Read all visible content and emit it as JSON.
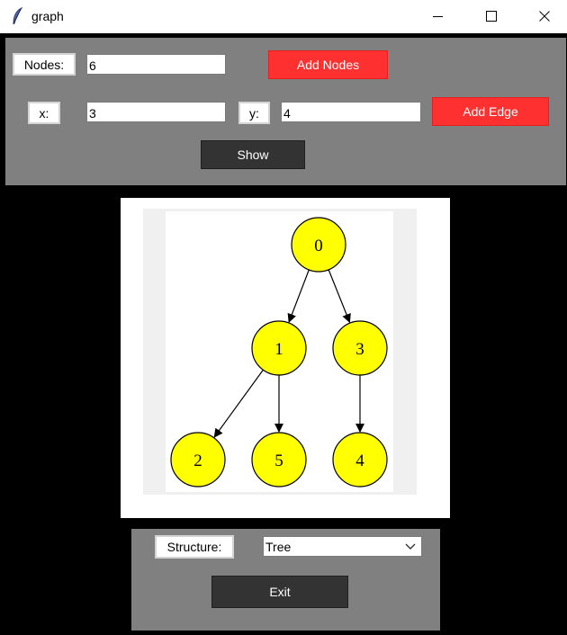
{
  "window": {
    "title": "graph",
    "app_icon": "feather-icon"
  },
  "controls": {
    "nodes_label": "Nodes:",
    "nodes_value": "6",
    "add_nodes_label": "Add Nodes",
    "x_label": "x:",
    "x_value": "3",
    "y_label": "y:",
    "y_value": "4",
    "add_edge_label": "Add Edge",
    "show_label": "Show"
  },
  "graph": {
    "nodes": [
      {
        "id": "0",
        "label": "0"
      },
      {
        "id": "1",
        "label": "1"
      },
      {
        "id": "3",
        "label": "3"
      },
      {
        "id": "2",
        "label": "2"
      },
      {
        "id": "5",
        "label": "5"
      },
      {
        "id": "4",
        "label": "4"
      }
    ],
    "edges": [
      {
        "from": "0",
        "to": "1"
      },
      {
        "from": "0",
        "to": "3"
      },
      {
        "from": "1",
        "to": "2"
      },
      {
        "from": "1",
        "to": "5"
      },
      {
        "from": "3",
        "to": "4"
      }
    ],
    "node_fill": "#ffff00"
  },
  "bottom": {
    "structure_label": "Structure:",
    "structure_value": "Tree",
    "exit_label": "Exit"
  },
  "colors": {
    "panel": "#808080",
    "accent_button": "#ff3030",
    "dark_button": "#333333",
    "window_bg": "#000000"
  }
}
